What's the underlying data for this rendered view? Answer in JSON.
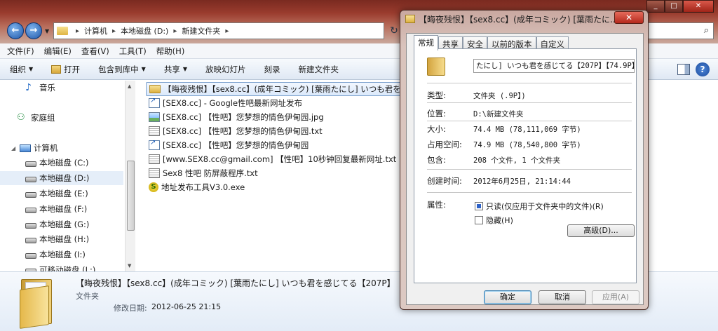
{
  "explorer": {
    "address": {
      "crumbs": [
        "计算机",
        "本地磁盘 (D:)",
        "新建文件夹"
      ]
    },
    "menu": [
      "文件(F)",
      "编辑(E)",
      "查看(V)",
      "工具(T)",
      "帮助(H)"
    ],
    "toolbar": {
      "organize": "组织",
      "open": "打开",
      "include": "包含到库中",
      "share": "共享",
      "slideshow": "放映幻灯片",
      "burn": "刻录",
      "new_folder": "新建文件夹"
    },
    "nav": {
      "music": "音乐",
      "homegroup": "家庭组",
      "computer": "计算机",
      "drives": [
        "本地磁盘 (C:)",
        "本地磁盘 (D:)",
        "本地磁盘 (E:)",
        "本地磁盘 (F:)",
        "本地磁盘 (G:)",
        "本地磁盘 (H:)",
        "本地磁盘 (I:)",
        "可移动磁盘 (L:)"
      ]
    },
    "files": [
      {
        "name": "【晦夜残恨】【sex8.cc】(成年コミック) [葉雨たにし] いつも君を感じてる【207P】【74.9P】",
        "icon": "folder-icon"
      },
      {
        "name": "[SEX8.cc] - Google性吧最新网址发布",
        "icon": "shortcut-icon"
      },
      {
        "name": "[SEX8.cc] 【性吧】您梦想的情色伊甸园.jpg",
        "icon": "image-icon"
      },
      {
        "name": "[SEX8.cc] 【性吧】您梦想的情色伊甸园.txt",
        "icon": "text-file-icon"
      },
      {
        "name": "[SEX8.cc] 【性吧】您梦想的情色伊甸园",
        "icon": "shortcut-icon"
      },
      {
        "name": "[www.SEX8.cc@gmail.com] 【性吧】10秒钟回复最新网址.txt",
        "icon": "text-file-icon"
      },
      {
        "name": "Sex8 性吧 防屏蔽程序.txt",
        "icon": "text-file-icon"
      },
      {
        "name": "地址发布工具V3.0.exe",
        "icon": "exe-icon"
      }
    ],
    "details": {
      "title": "【晦夜残恨】【sex8.cc】(成年コミック) [葉雨たにし] いつも君を感じてる【207P】",
      "type": "文件夹",
      "date_label": "修改日期:",
      "date": "2012-06-25 21:15"
    }
  },
  "dialog": {
    "title": "【晦夜残恨】【sex8.cc】(成年コミック) [葉雨たに...",
    "tabs": [
      "常规",
      "共享",
      "安全",
      "以前的版本",
      "自定义"
    ],
    "name_field": "たにし] いつも君を感じてる【207P】【74.9P】",
    "props": {
      "type_label": "类型:",
      "type_value": "文件夹 (.9P】)",
      "location_label": "位置:",
      "location_value": "D:\\新建文件夹",
      "size_label": "大小:",
      "size_value": "74.4 MB (78,111,069 字节)",
      "disk_label": "占用空间:",
      "disk_value": "74.9 MB (78,540,800 字节)",
      "contains_label": "包含:",
      "contains_value": "208 个文件, 1 个文件夹",
      "created_label": "创建时间:",
      "created_value": "2012年6月25日, 21:14:44",
      "attr_label": "属性:"
    },
    "readonly_label": "只读(仅应用于文件夹中的文件)(R)",
    "hidden_label": "隐藏(H)",
    "advanced_label": "高级(D)...",
    "ok": "确定",
    "cancel": "取消",
    "apply": "应用(A)"
  }
}
